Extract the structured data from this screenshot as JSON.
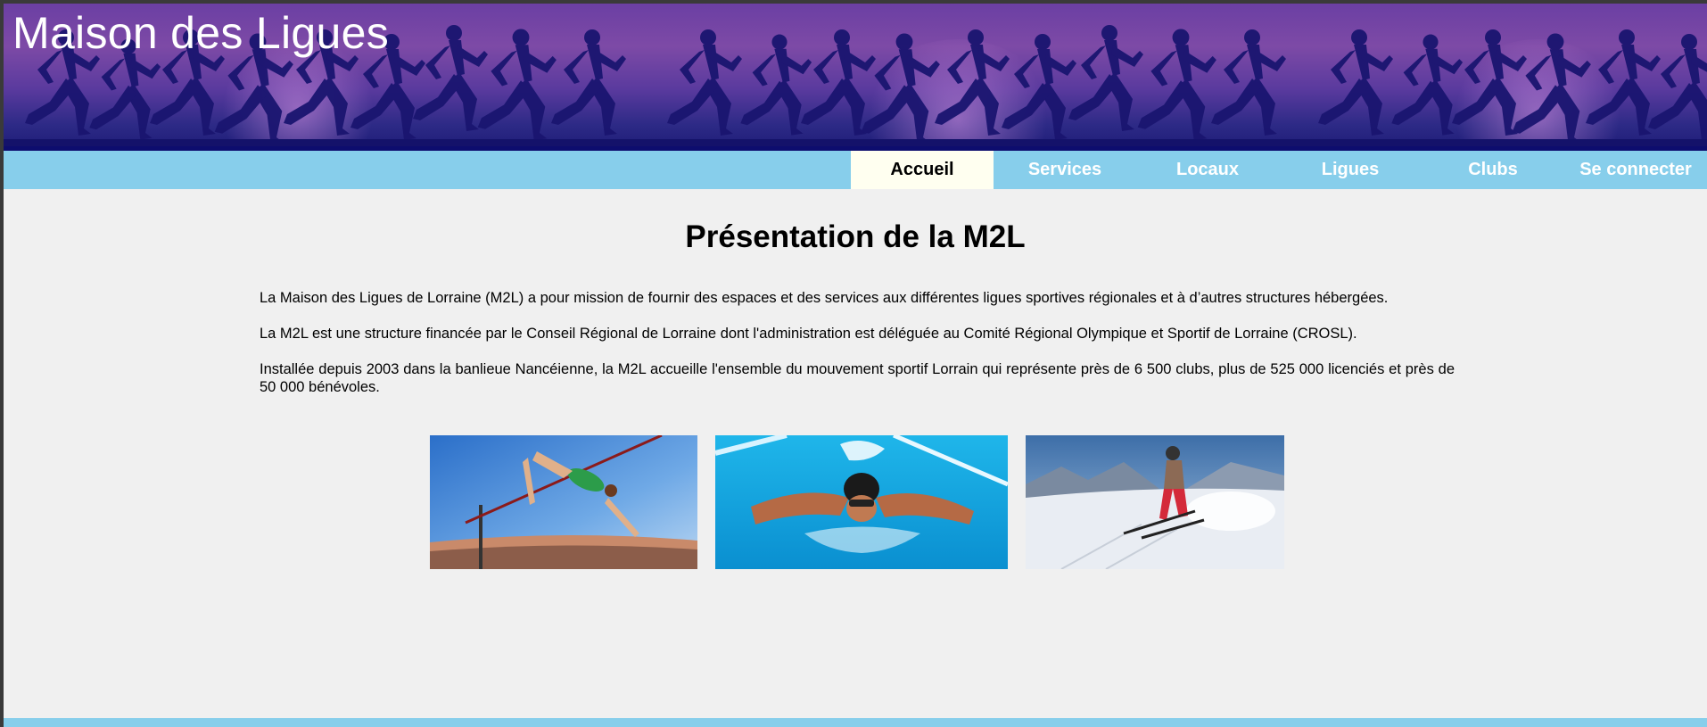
{
  "header": {
    "site_title": "Maison des Ligues"
  },
  "nav": {
    "items": [
      {
        "label": "Accueil",
        "active": true
      },
      {
        "label": "Services",
        "active": false
      },
      {
        "label": "Locaux",
        "active": false
      },
      {
        "label": "Ligues",
        "active": false
      },
      {
        "label": "Clubs",
        "active": false
      },
      {
        "label": "Se connecter",
        "active": false
      }
    ]
  },
  "main": {
    "title": "Présentation de la M2L",
    "paragraphs": [
      "La Maison des Ligues de Lorraine (M2L) a pour mission de fournir des espaces et des services aux différentes ligues sportives régionales et à d’autres structures hébergées.",
      "La M2L est une structure financée par le Conseil Régional de Lorraine dont l'administration est déléguée au Comité Régional Olympique et Sportif de Lorraine (CROSL).",
      "Installée depuis 2003 dans la banlieue Nancéienne, la M2L accueille l'ensemble du mouvement sportif Lorrain qui représente près de 6 500 clubs, plus de 525 000 licenciés et près de 50 000 bénévoles."
    ],
    "gallery": [
      "high-jump-photo",
      "swimming-photo",
      "skiing-photo"
    ]
  },
  "colors": {
    "nav_background": "#87ceeb",
    "nav_active_background": "#fffff0",
    "page_background": "#f0f0f0",
    "banner_dark": "#201e7a"
  }
}
